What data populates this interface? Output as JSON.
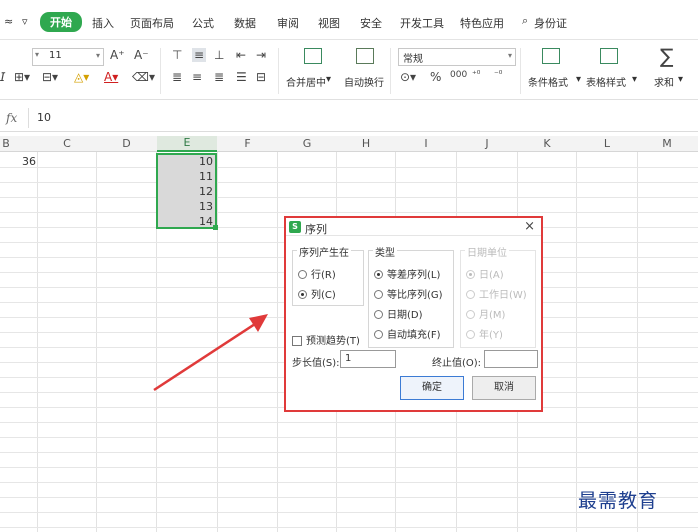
{
  "ribbon": {
    "tabs": [
      "开始",
      "插入",
      "页面布局",
      "公式",
      "数据",
      "审阅",
      "视图",
      "安全",
      "开发工具",
      "特色应用"
    ],
    "search_label": "身份证",
    "font_size": "11",
    "number_format": "常规",
    "merge_center": "合并居中",
    "wrap_text": "自动换行",
    "conditional_format": "条件格式",
    "table_style": "表格样式",
    "sum": "求和",
    "percent": "%",
    "thousands": "000"
  },
  "formula_bar": {
    "fx": "fx",
    "value": "10"
  },
  "grid": {
    "columns": [
      "B",
      "C",
      "D",
      "E",
      "F",
      "G",
      "H",
      "I",
      "J",
      "K",
      "L",
      "M"
    ],
    "selected_column": "E",
    "b_value": "36",
    "e_values": [
      "10",
      "11",
      "12",
      "13",
      "14"
    ]
  },
  "dialog": {
    "title": "序列",
    "close": "×",
    "group_series_in": "序列产生在",
    "opt_rows": "行(R)",
    "opt_columns": "列(C)",
    "group_type": "类型",
    "type_linear": "等差序列(L)",
    "type_growth": "等比序列(G)",
    "type_date": "日期(D)",
    "type_autofill": "自动填充(F)",
    "group_date_unit": "日期单位",
    "unit_day": "日(A)",
    "unit_weekday": "工作日(W)",
    "unit_month": "月(M)",
    "unit_year": "年(Y)",
    "trend": "预测趋势(T)",
    "step_label": "步长值(S):",
    "step_value": "1",
    "stop_label": "终止值(O):",
    "stop_value": "",
    "ok": "确定",
    "cancel": "取消"
  },
  "watermark": "最需教育",
  "colors": {
    "accent": "#2fa84f",
    "highlight_border": "#e03a3a",
    "arrow": "#e03a3a"
  }
}
